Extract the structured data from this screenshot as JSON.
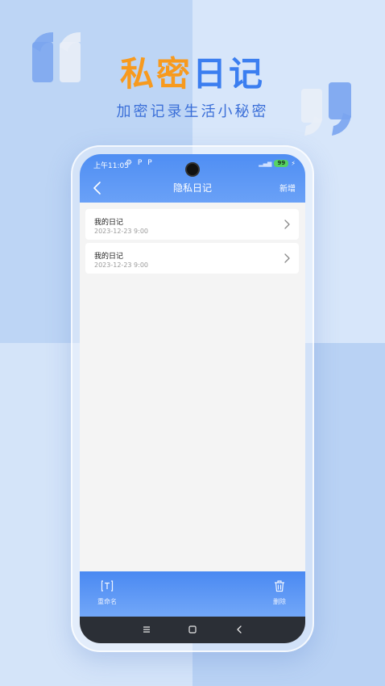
{
  "promo": {
    "title_part1": "私密",
    "title_part2": "日记",
    "subtitle": "加密记录生活小秘密"
  },
  "status_bar": {
    "time": "上午11:05",
    "left_icons": "⚙ P P",
    "battery": "99"
  },
  "nav": {
    "title": "隐私日记",
    "add_label": "新增"
  },
  "diary_list": [
    {
      "title": "我的日记",
      "date": "2023-12-23 9:00"
    },
    {
      "title": "我的日记",
      "date": "2023-12-23 9:00"
    }
  ],
  "toolbar": {
    "rename_label": "重命名",
    "delete_label": "删除"
  },
  "colors": {
    "accent_blue": "#4f8ef3",
    "title_orange": "#f79a1e",
    "title_blue": "#3b7ef0"
  }
}
